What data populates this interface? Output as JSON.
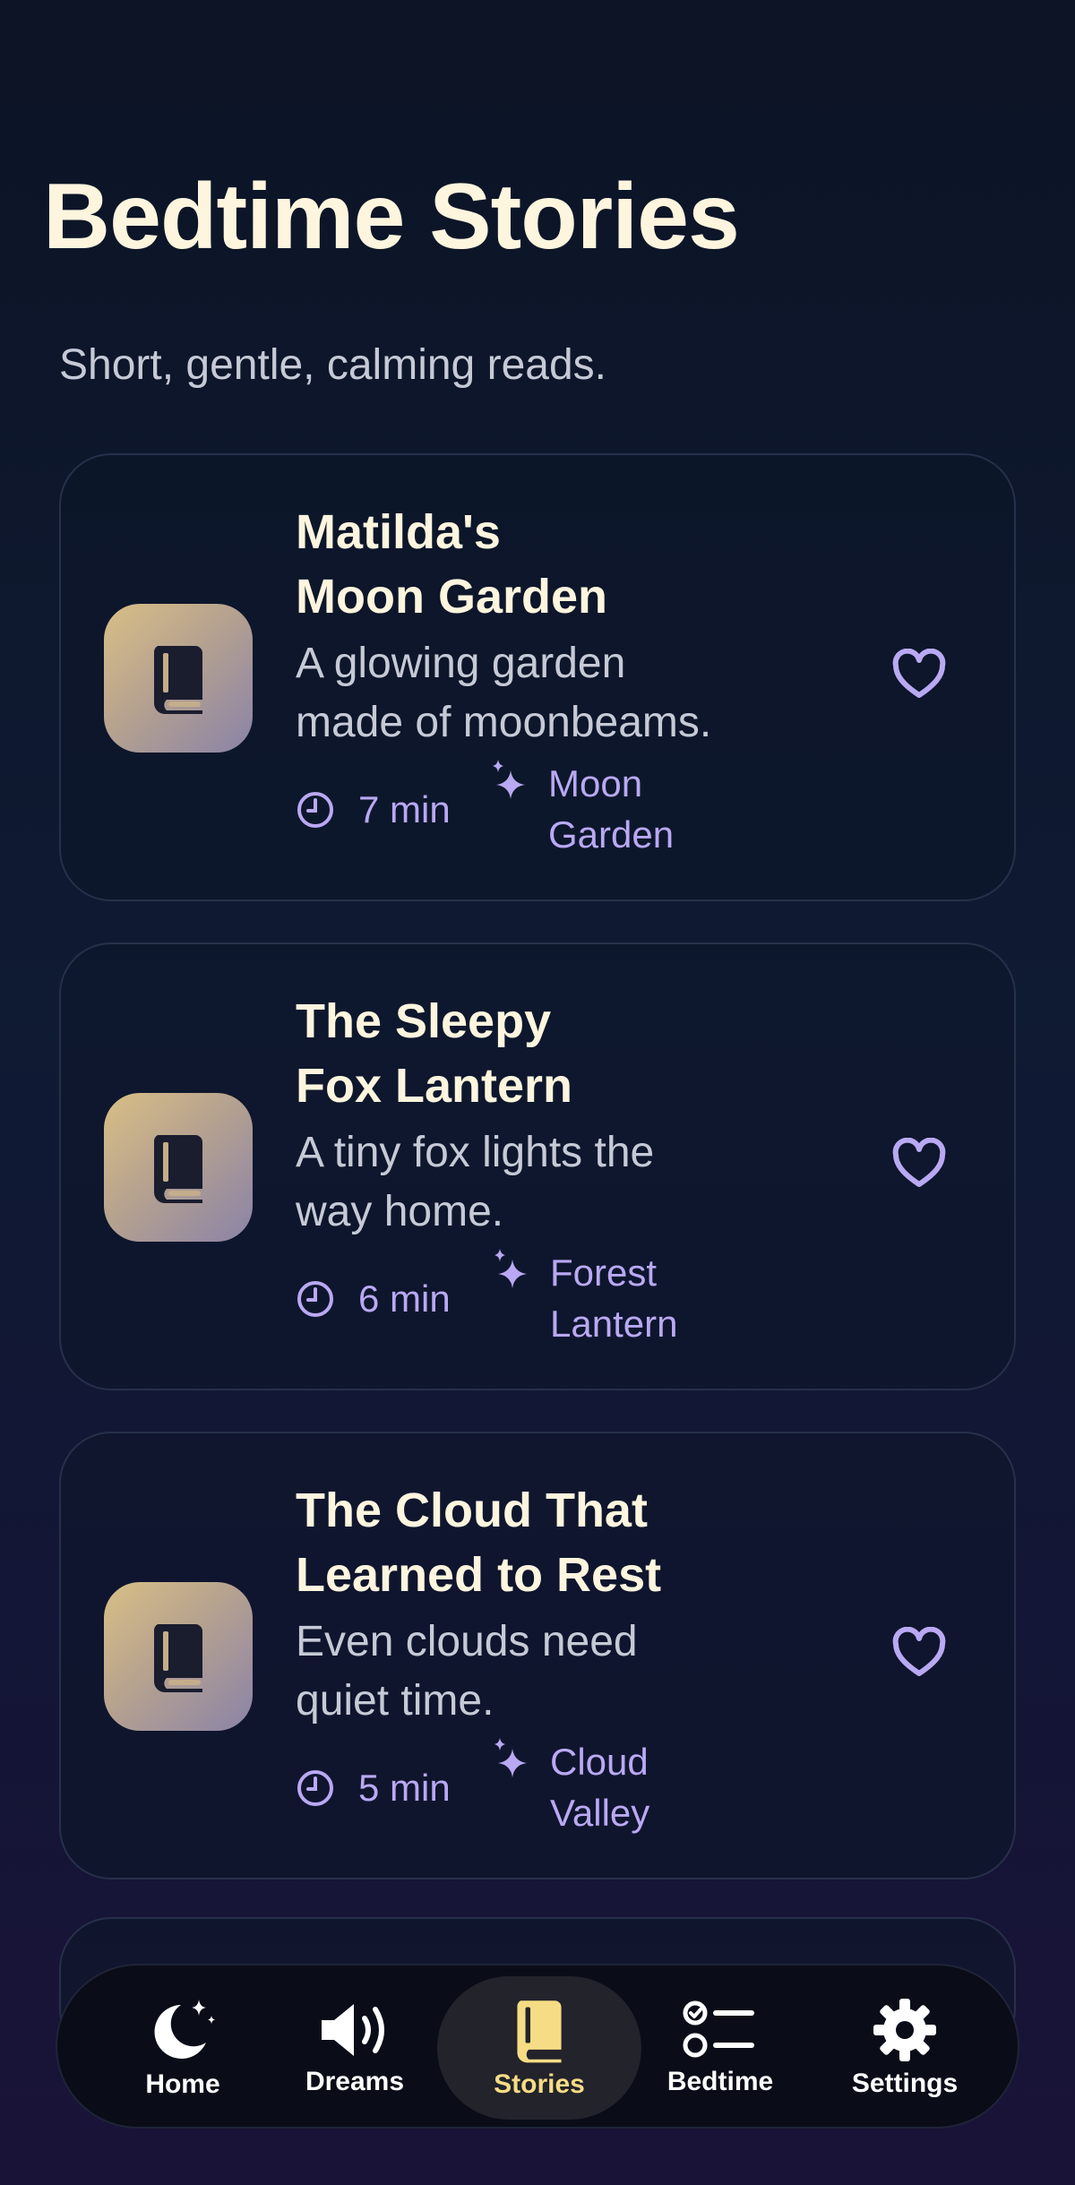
{
  "page": {
    "title": "Bedtime Stories",
    "subtitle": "Short, gentle, calming reads."
  },
  "stories": [
    {
      "title_line1": "Matilda's",
      "title_line2": "Moon Garden",
      "desc_line1": "A glowing garden",
      "desc_line2": "made of moonbeams.",
      "duration": "7 min",
      "tag_line1": "Moon",
      "tag_line2": "Garden",
      "favorite": false
    },
    {
      "title_line1": "The Sleepy",
      "title_line2": "Fox Lantern",
      "desc_line1": "A tiny fox lights the",
      "desc_line2": "way home.",
      "duration": "6 min",
      "tag_line1": "Forest",
      "tag_line2": "Lantern",
      "favorite": false
    },
    {
      "title_line1": "The Cloud That",
      "title_line2": "Learned to Rest",
      "desc_line1": "Even clouds need",
      "desc_line2": "quiet time.",
      "duration": "5 min",
      "tag_line1": "Cloud",
      "tag_line2": "Valley",
      "favorite": false
    }
  ],
  "tabs": [
    {
      "label": "Home",
      "icon": "moon-stars-icon"
    },
    {
      "label": "Dreams",
      "icon": "speaker-icon"
    },
    {
      "label": "Stories",
      "icon": "book-icon",
      "active": true
    },
    {
      "label": "Bedtime",
      "icon": "checklist-icon"
    },
    {
      "label": "Settings",
      "icon": "gear-icon"
    }
  ],
  "colors": {
    "accent": "#b9a9f3",
    "active_tab": "#f6dc84",
    "title": "#fdf5de"
  }
}
